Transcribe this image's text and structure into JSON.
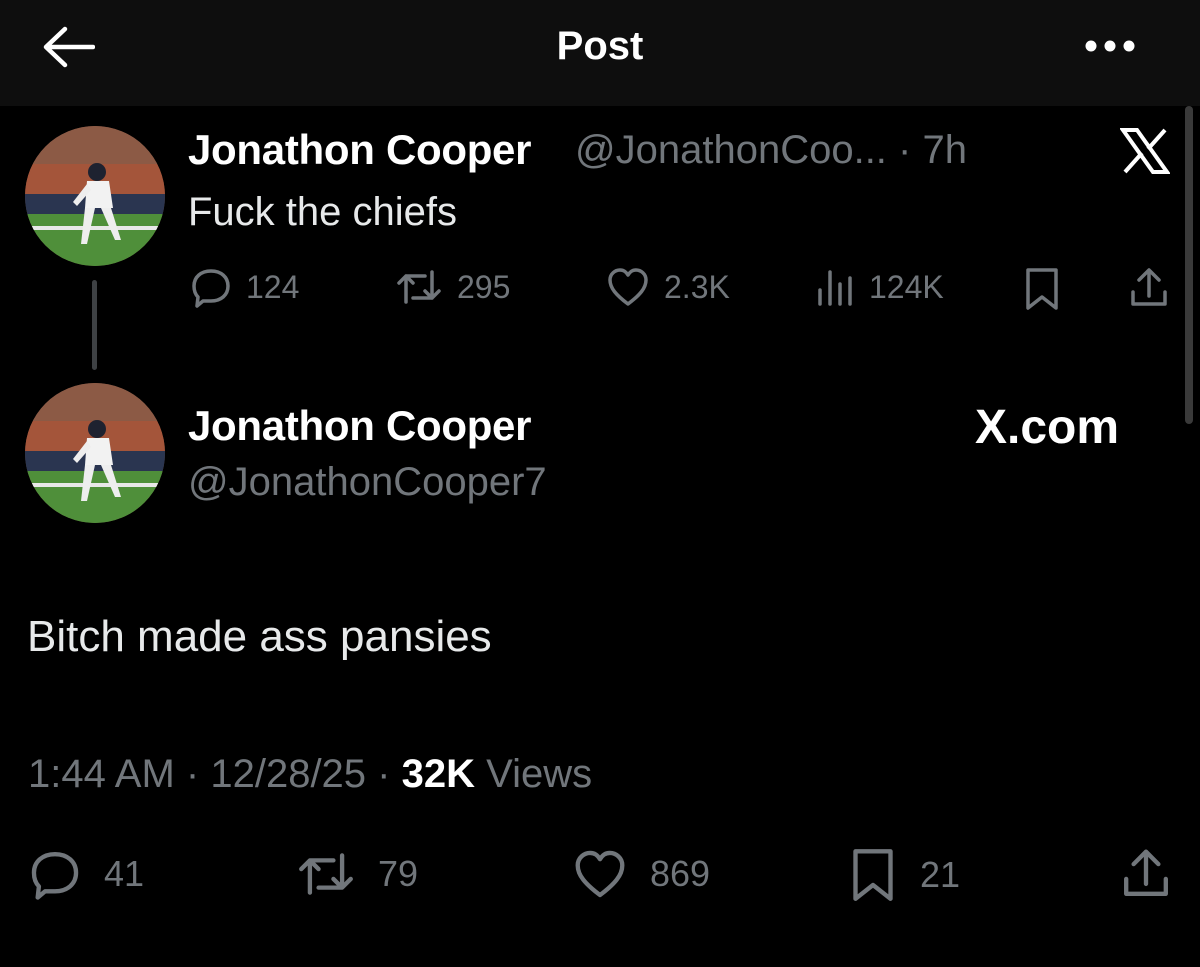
{
  "header": {
    "title": "Post",
    "back_icon": "arrow-left-icon",
    "more_icon": "more-dots-icon"
  },
  "parent_tweet": {
    "author_name": "Jonathon Cooper",
    "author_handle": "@JonathonCoo...",
    "separator": "·",
    "time_ago": "7h",
    "text": "Fuck the chiefs",
    "corner_logo": "x-logo-icon",
    "actions": {
      "replies": "124",
      "reposts": "295",
      "likes": "2.3K",
      "views": "124K"
    }
  },
  "main_tweet": {
    "author_name": "Jonathon Cooper",
    "author_handle": "@JonathonCooper7",
    "watermark": "X.com",
    "text": "Bitch made ass pansies",
    "time": "1:44 AM",
    "date": "12/28/25",
    "separator": "·",
    "views_count": "32K",
    "views_label": "Views",
    "actions": {
      "replies": "41",
      "reposts": "79",
      "likes": "869",
      "bookmarks": "21"
    }
  },
  "colors": {
    "background": "#000000",
    "header_bg": "#0e0e0e",
    "text_primary": "#e7e9ea",
    "text_muted": "#71767b"
  }
}
